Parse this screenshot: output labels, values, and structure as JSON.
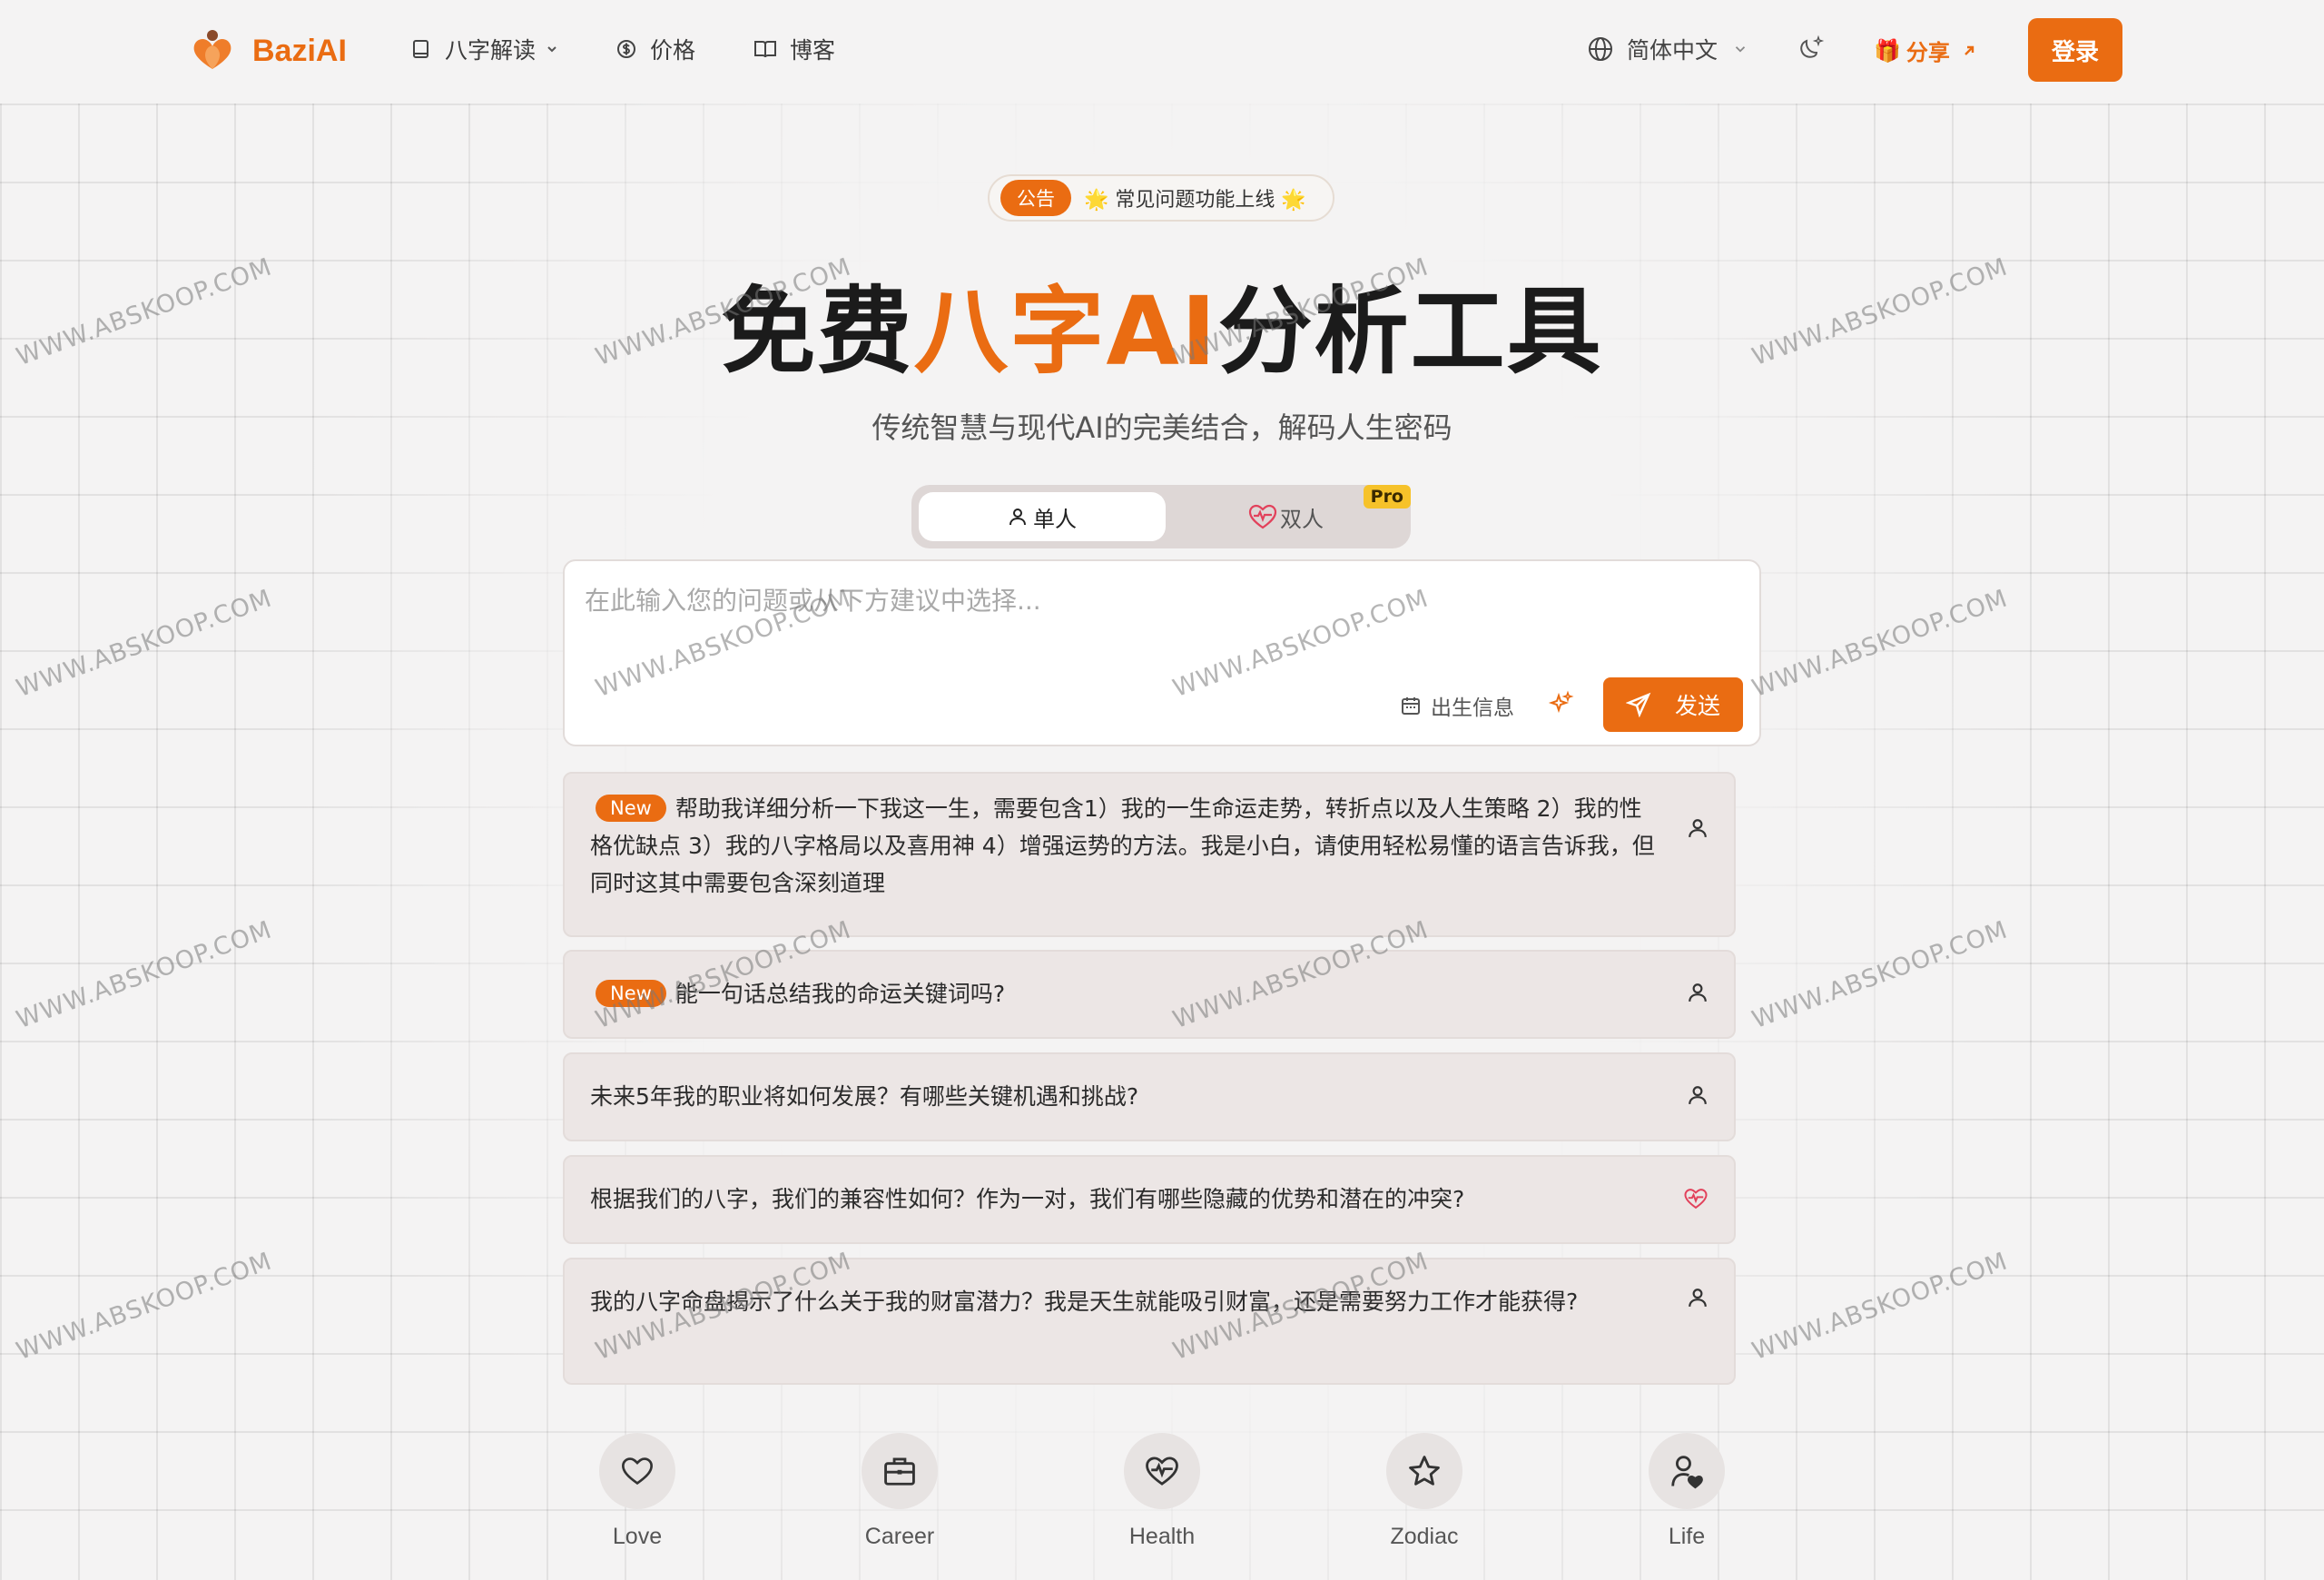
{
  "header": {
    "brand": "BaziAI",
    "nav": [
      {
        "label": "八字解读",
        "icon": "book-icon"
      },
      {
        "label": "价格",
        "icon": "dollar-circle-icon"
      },
      {
        "label": "博客",
        "icon": "open-book-icon"
      }
    ],
    "language": "简体中文",
    "share_label": "分享",
    "login_label": "登录"
  },
  "announcement": {
    "badge": "公告",
    "text": "🌟 常见问题功能上线 🌟"
  },
  "hero": {
    "title_pre": "免费",
    "title_highlight": "八字AI",
    "title_post": "分析工具",
    "subtitle": "传统智慧与现代AI的完美结合，解码人生密码"
  },
  "mode_toggle": {
    "single": "单人",
    "double": "双人",
    "pro_badge": "Pro"
  },
  "input": {
    "placeholder": "在此输入您的问题或从下方建议中选择...",
    "birth_info": "出生信息",
    "send": "发送"
  },
  "suggestions": [
    {
      "new": true,
      "badge": "New",
      "text": "帮助我详细分析一下我这一生，需要包含1）我的一生命运走势，转折点以及人生策略 2）我的性格优缺点 3）我的八字格局以及喜用神 4）增强运势的方法。我是小白，请使用轻松易懂的语言告诉我，但同时这其中需要包含深刻道理",
      "icon": "person-icon"
    },
    {
      "new": true,
      "badge": "New",
      "text": "能一句话总结我的命运关键词吗?",
      "icon": "person-icon"
    },
    {
      "new": false,
      "text": "未来5年我的职业将如何发展？有哪些关键机遇和挑战?",
      "icon": "person-icon"
    },
    {
      "new": false,
      "text": "根据我们的八字，我们的兼容性如何？作为一对，我们有哪些隐藏的优势和潜在的冲突?",
      "icon": "heart-pulse-icon"
    },
    {
      "new": false,
      "text": "我的八字命盘揭示了什么关于我的财富潜力？我是天生就能吸引财富，还是需要努力工作才能获得?",
      "icon": "person-icon"
    }
  ],
  "categories": [
    {
      "label": "Love",
      "icon": "heart-icon"
    },
    {
      "label": "Career",
      "icon": "briefcase-icon"
    },
    {
      "label": "Health",
      "icon": "heart-pulse-icon"
    },
    {
      "label": "Zodiac",
      "icon": "star-icon"
    },
    {
      "label": "Life",
      "icon": "user-heart-icon"
    }
  ],
  "watermark": "WWW.ABSKOOP.COM",
  "colors": {
    "accent": "#ea6c12",
    "pro": "#f6c22a",
    "heart": "#e2415b"
  }
}
